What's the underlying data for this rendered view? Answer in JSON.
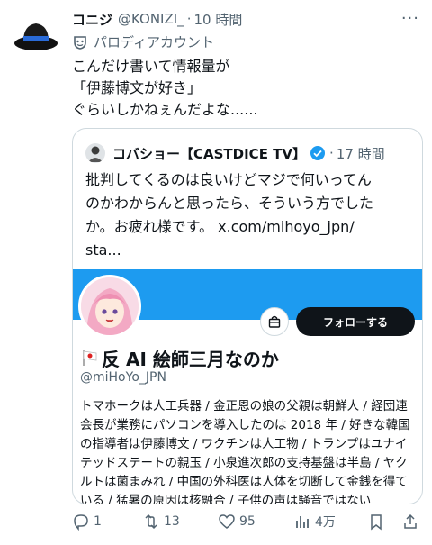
{
  "tweet": {
    "author_name": "コニジ",
    "handle": "@KONIZI_",
    "separator": "·",
    "time": "10 時間",
    "more_label": "···",
    "parody_label": "パロディアカウント",
    "text_lines": [
      "こんだけ書いて情報量が",
      "「伊藤博文が好き」",
      "ぐらいしかねぇんだよな......"
    ]
  },
  "quote": {
    "author_name": "コバショー【CASTDICE TV】",
    "separator": "·",
    "time": "17 時間",
    "text_lines": [
      "批判してくるのは良いけどマジで何いってん",
      "のかわからんと思ったら、そういう方でした",
      "か。お疲れ様です。 x.com/mihoyo_jpn/",
      "sta..."
    ],
    "card": {
      "follow_label": "フォローする",
      "display_name": "反 AI 絵師三月なのか",
      "handle": "@miHoYo_JPN",
      "bio_lines": [
        "トマホークは人工兵器 / 金正恩の娘の父親は朝鮮人 / 経団連",
        "会長が業務にパソコンを導入したのは 2018 年 / 好きな韓国",
        "の指導者は伊藤博文 / ワクチンは人工物 / トランプはユナイ",
        "テッドステートの親玉 / 小泉進次郎の支持基盤は半島 / ヤク",
        "ルトは菌まみれ / 中国の外科医は人体を切断して金銭を得て",
        "いる / 猛暑の原因は核融合 / 子供の声は騒音ではない"
      ]
    }
  },
  "actions": {
    "replies": "1",
    "reposts": "13",
    "likes": "95",
    "views": "4万"
  },
  "colors": {
    "accent": "#1d9bf0",
    "text": "#0f1419",
    "muted": "#536471",
    "border": "#cfd9de"
  }
}
